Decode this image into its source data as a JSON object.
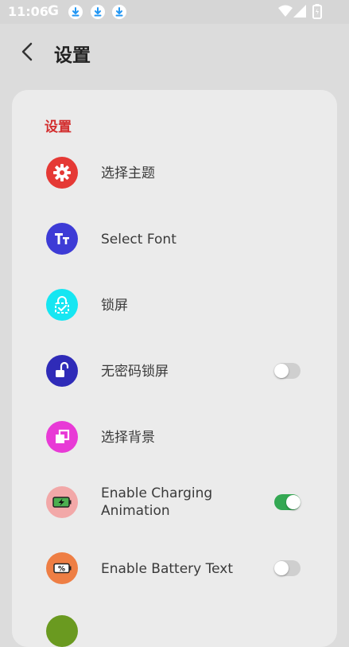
{
  "status_bar": {
    "time": "11:06",
    "g_label": "G",
    "download_icons": [
      "download-icon",
      "download-icon",
      "download-icon"
    ],
    "accent": "#2196f3"
  },
  "header": {
    "back_icon": "chevron-left-icon",
    "title": "设置"
  },
  "card": {
    "section_title": "设置",
    "section_color": "#d32f2f",
    "items": [
      {
        "label": "选择主题",
        "icon": "gear-icon",
        "icon_bg": "#e53935",
        "toggle": null
      },
      {
        "label": "Select Font",
        "icon": "font-icon",
        "icon_bg": "#3d3bd6",
        "toggle": null
      },
      {
        "label": "锁屏",
        "icon": "lock-check-icon",
        "icon_bg": "#16e6f2",
        "toggle": null
      },
      {
        "label": "无密码锁屏",
        "icon": "unlock-icon",
        "icon_bg": "#2f2bb8",
        "toggle": false
      },
      {
        "label": "选择背景",
        "icon": "copy-icon",
        "icon_bg": "#e83ad6",
        "toggle": null
      },
      {
        "label": "Enable Charging",
        "label2": "Animation",
        "icon": "battery-charging-icon",
        "icon_bg": "#f2a8a8",
        "toggle": true
      },
      {
        "label": "Enable Battery Text",
        "icon": "battery-percent-icon",
        "icon_bg": "#ee7e44",
        "toggle": false
      }
    ],
    "partial_icon_bg": "#6a9a20"
  }
}
